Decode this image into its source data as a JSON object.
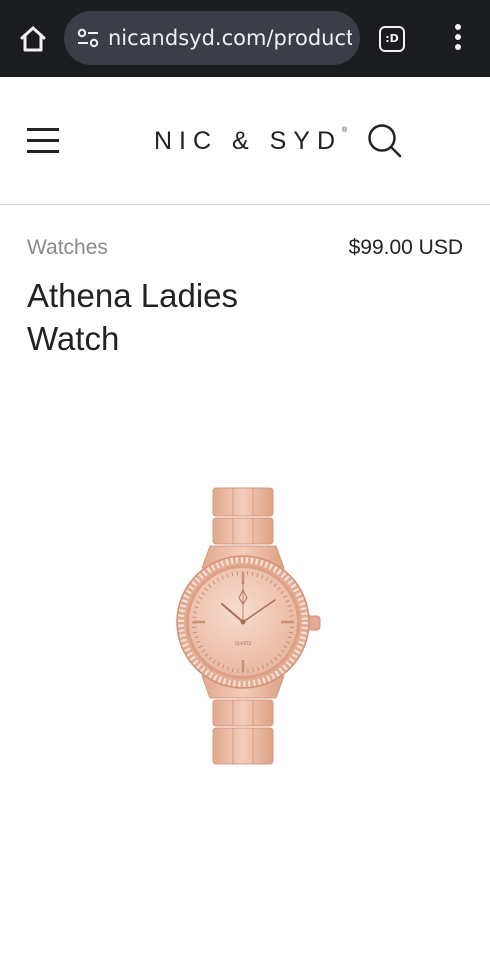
{
  "browser": {
    "url": "nicandsyd.com/products",
    "tabs_label": ":D"
  },
  "header": {
    "logo": "NIC & SYD",
    "logo_mark": "®"
  },
  "product": {
    "category": "Watches",
    "price": "$99.00 USD",
    "title_line1": "Athena Ladies",
    "title_line2": "Watch",
    "dial_text": "QUARTZ"
  },
  "colors": {
    "browser_bg": "#1b1c20",
    "url_pill": "#3b3e47",
    "rose_gold": "#e8b59e"
  }
}
